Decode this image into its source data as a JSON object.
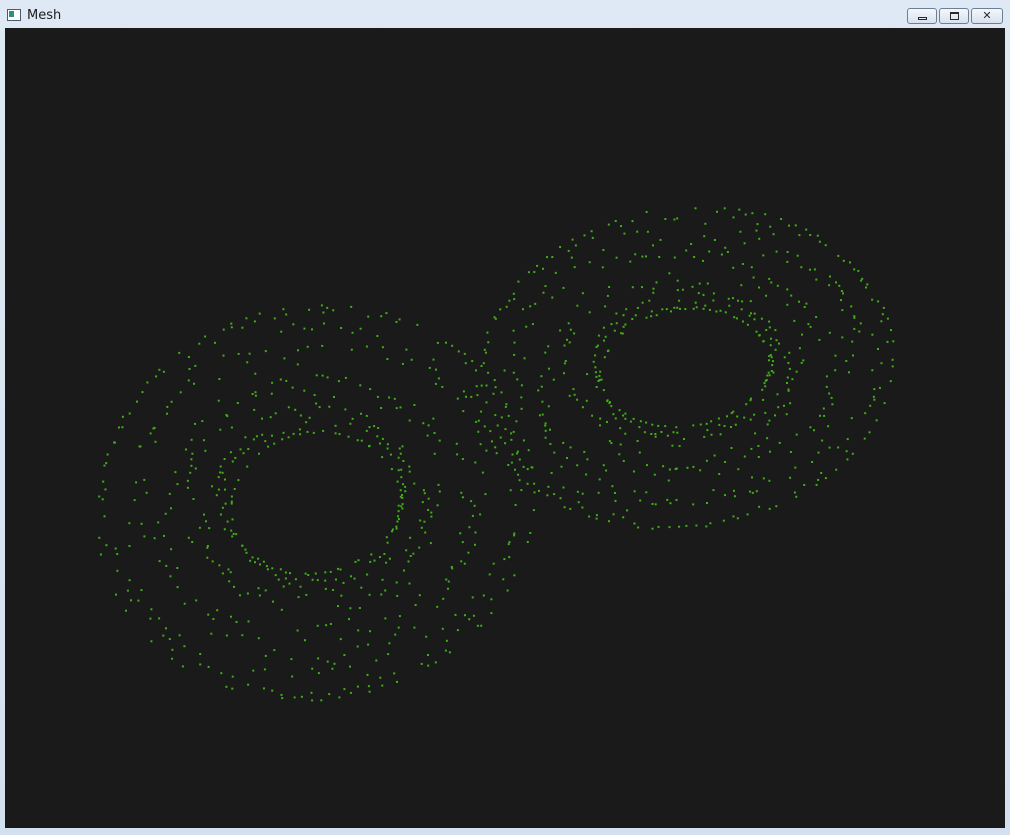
{
  "window": {
    "title": "Mesh",
    "buttons": {
      "minimize_icon": "minimize-icon",
      "maximize_icon": "maximize-icon",
      "close_icon": "close-icon"
    }
  },
  "viewport": {
    "background": "#1a1a1a",
    "point_color": "#3fae18"
  }
}
